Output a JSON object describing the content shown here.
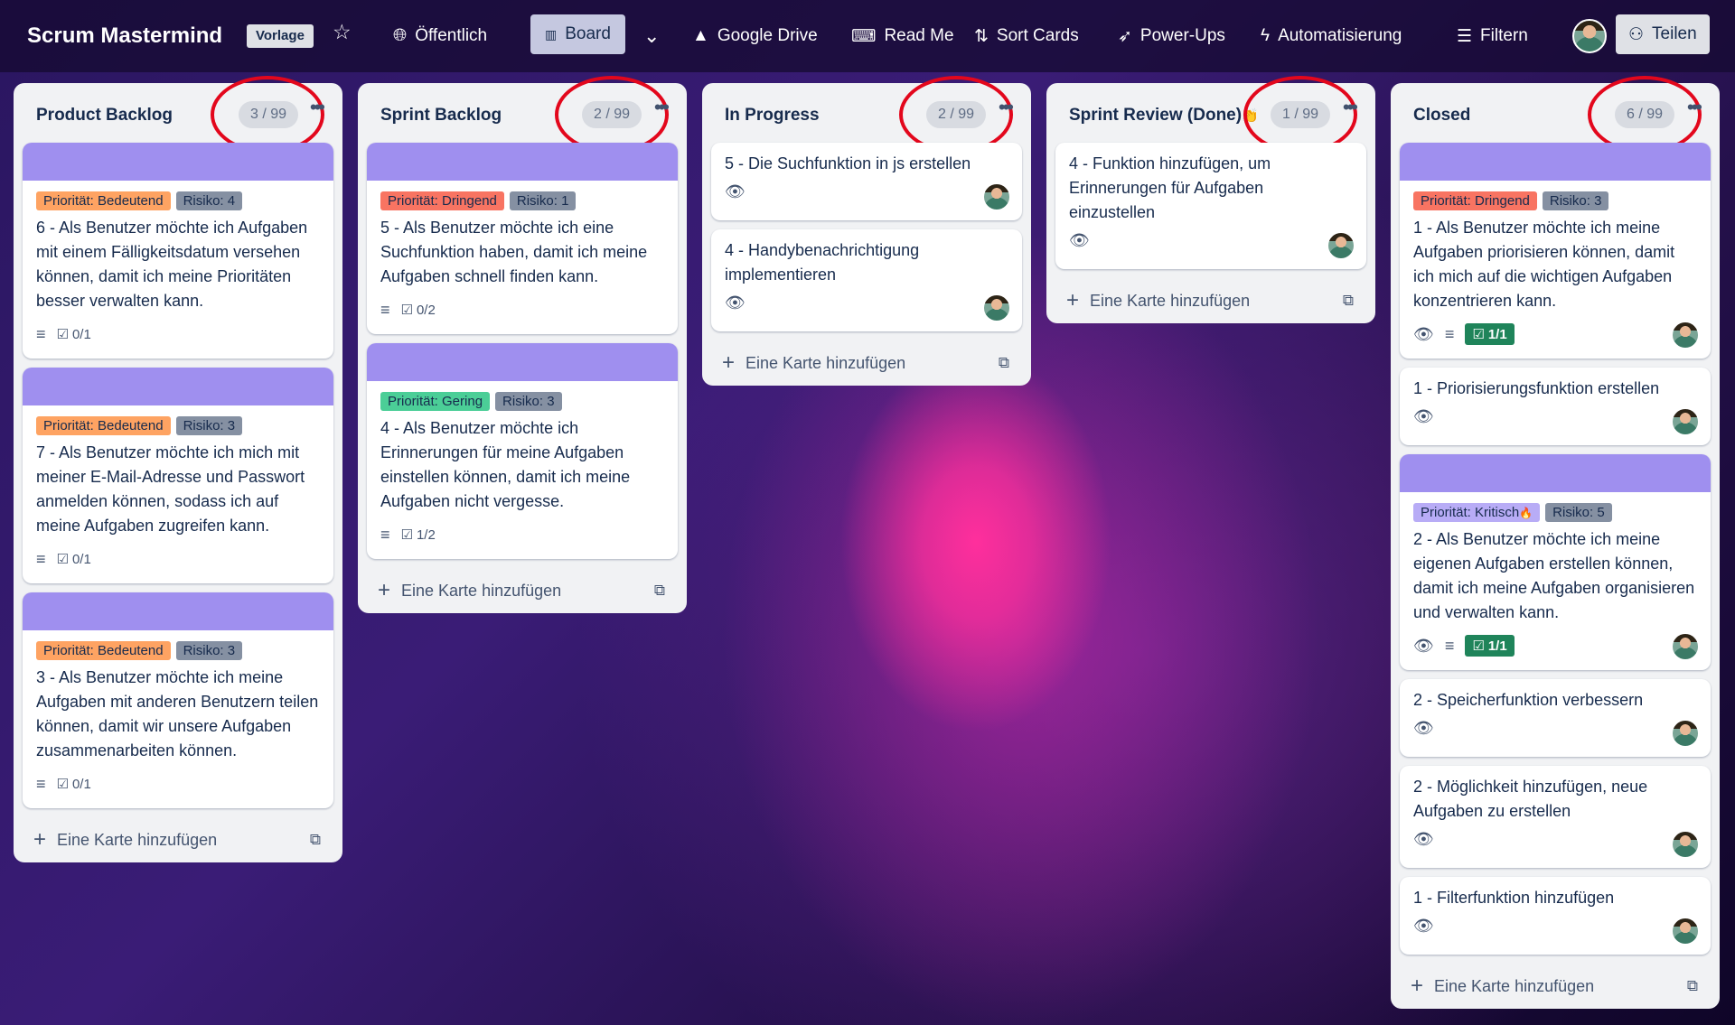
{
  "header": {
    "title": "Scrum Mastermind",
    "template_badge": "Vorlage",
    "visibility": "Öffentlich",
    "view": "Board",
    "google_drive": "Google Drive",
    "read_me": "Read Me",
    "sort_cards": "Sort Cards",
    "power_ups": "Power-Ups",
    "automation": "Automatisierung",
    "filter": "Filtern",
    "share": "Teilen"
  },
  "add_card_label": "Eine Karte hinzufügen",
  "lists": [
    {
      "name": "Product Backlog",
      "count": "3 / 99",
      "cards": [
        {
          "labels": [
            {
              "text": "Priorität: Bedeutend",
              "kind": "bed"
            },
            {
              "text": "Risiko: 4",
              "kind": "ris"
            }
          ],
          "title": "6 - Als Benutzer möchte ich Aufgaben mit einem Fälligkeitsdatum versehen können, damit ich meine Prioritäten besser verwalten kann.",
          "checklist": "0/1"
        },
        {
          "labels": [
            {
              "text": "Priorität: Bedeutend",
              "kind": "bed"
            },
            {
              "text": "Risiko: 3",
              "kind": "ris"
            }
          ],
          "title": "7 - Als Benutzer möchte ich mich mit meiner E-Mail-Adresse und Passwort anmelden können, sodass ich auf meine Aufgaben zugreifen kann.",
          "checklist": "0/1"
        },
        {
          "labels": [
            {
              "text": "Priorität: Bedeutend",
              "kind": "bed"
            },
            {
              "text": "Risiko: 3",
              "kind": "ris"
            }
          ],
          "title": "3 - Als Benutzer möchte ich meine Aufgaben mit anderen Benutzern teilen können, damit wir unsere Aufgaben zusammenarbeiten können.",
          "checklist": "0/1"
        }
      ]
    },
    {
      "name": "Sprint Backlog",
      "count": "2 / 99",
      "cards": [
        {
          "labels": [
            {
              "text": "Priorität: Dringend",
              "kind": "dri"
            },
            {
              "text": "Risiko: 1",
              "kind": "ris"
            }
          ],
          "title": "5 - Als Benutzer möchte ich eine Suchfunktion haben, damit ich meine Aufgaben schnell finden kann.",
          "checklist": "0/2"
        },
        {
          "labels": [
            {
              "text": "Priorität: Gering",
              "kind": "ger"
            },
            {
              "text": "Risiko: 3",
              "kind": "ris"
            }
          ],
          "title": "4 - Als Benutzer möchte ich Erinnerungen für meine Aufgaben einstellen können, damit ich meine Aufgaben nicht vergesse.",
          "checklist": "1/2"
        }
      ]
    },
    {
      "name": "In Progress",
      "count": "2 / 99",
      "cards": [
        {
          "title": "5 - Die Suchfunktion in js erstellen"
        },
        {
          "title": "4 - Handybenachrichtigung implementieren"
        }
      ]
    },
    {
      "name": "Sprint Review (Done)",
      "name_emoji": "👏",
      "count": "1 / 99",
      "cards": [
        {
          "title": "4 - Funktion hinzufügen, um Erinnerungen für Aufgaben einzustellen"
        }
      ]
    },
    {
      "name": "Closed",
      "count": "6 / 99",
      "cards": [
        {
          "labels": [
            {
              "text": "Priorität: Dringend",
              "kind": "dri"
            },
            {
              "text": "Risiko: 3",
              "kind": "ris"
            }
          ],
          "title": "1 - Als Benutzer möchte ich meine Aufgaben priorisieren können, damit ich mich auf die wichtigen Aufgaben konzentrieren kann.",
          "checklist": "1/1"
        },
        {
          "title": "1 - Priorisierungsfunktion erstellen"
        },
        {
          "labels": [
            {
              "text": "Priorität: Kritisch",
              "kind": "kri",
              "emoji": "🔥"
            },
            {
              "text": "Risiko: 5",
              "kind": "ris"
            }
          ],
          "title": "2 - Als Benutzer möchte ich meine eigenen Aufgaben erstellen können, damit ich meine Aufgaben organisieren und verwalten kann.",
          "checklist": "1/1"
        },
        {
          "title": "2 - Speicherfunktion verbessern"
        },
        {
          "title": "2 - Möglichkeit hinzufügen, neue Aufgaben zu erstellen"
        },
        {
          "title": "1 - Filterfunktion hinzufügen"
        }
      ]
    }
  ]
}
